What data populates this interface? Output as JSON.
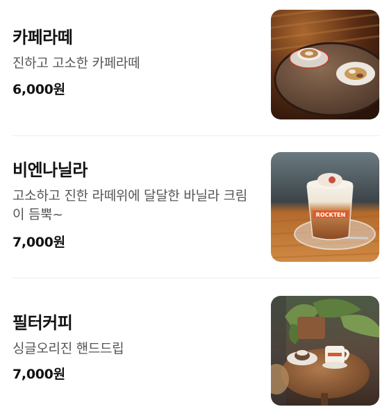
{
  "menu": {
    "items": [
      {
        "name": "카페라떼",
        "description": "진하고 고소한 카페라떼",
        "price": "6,000원",
        "photo": "latte-photo"
      },
      {
        "name": "비엔나닐라",
        "description": "고소하고 진한 라떼위에 달달한 바닐라 크림이 듬뿍~",
        "price": "7,000원",
        "photo": "vienna-photo"
      },
      {
        "name": "필터커피",
        "description": "싱글오리진 핸드드립",
        "price": "7,000원",
        "photo": "filter-coffee-photo"
      }
    ],
    "mug_text": "ROCKTEN"
  }
}
